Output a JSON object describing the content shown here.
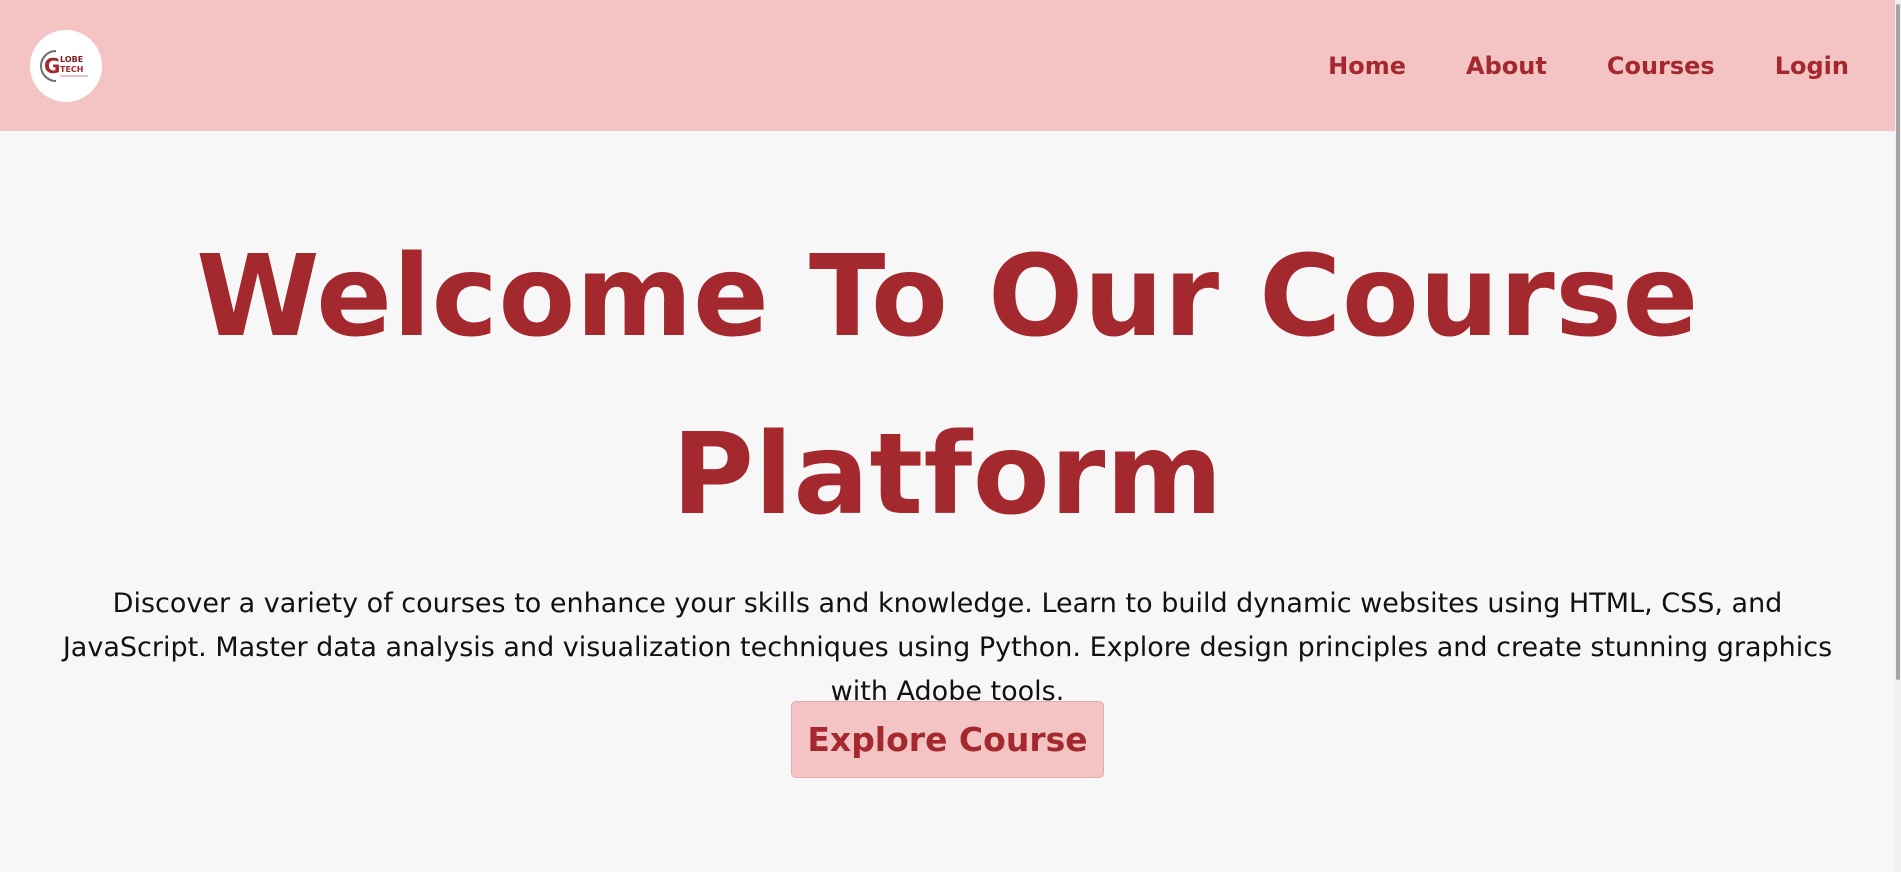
{
  "header": {
    "logo": {
      "text_top": "LOBE",
      "text_bottom": "TECH",
      "letter": "G"
    },
    "nav": [
      {
        "label": "Home"
      },
      {
        "label": "About"
      },
      {
        "label": "Courses"
      },
      {
        "label": "Login"
      }
    ]
  },
  "hero": {
    "title": "Welcome To Our Course Platform",
    "description": "Discover a variety of courses to enhance your skills and knowledge. Learn to build dynamic websites using HTML, CSS, and JavaScript. Master data analysis and visualization techniques using Python. Explore design principles and create stunning graphics with Adobe tools.",
    "button_label": "Explore Course"
  },
  "colors": {
    "accent": "#a4292f",
    "header_bg": "#f4c3c4",
    "page_bg": "#f8f7f7",
    "text": "#111111"
  }
}
